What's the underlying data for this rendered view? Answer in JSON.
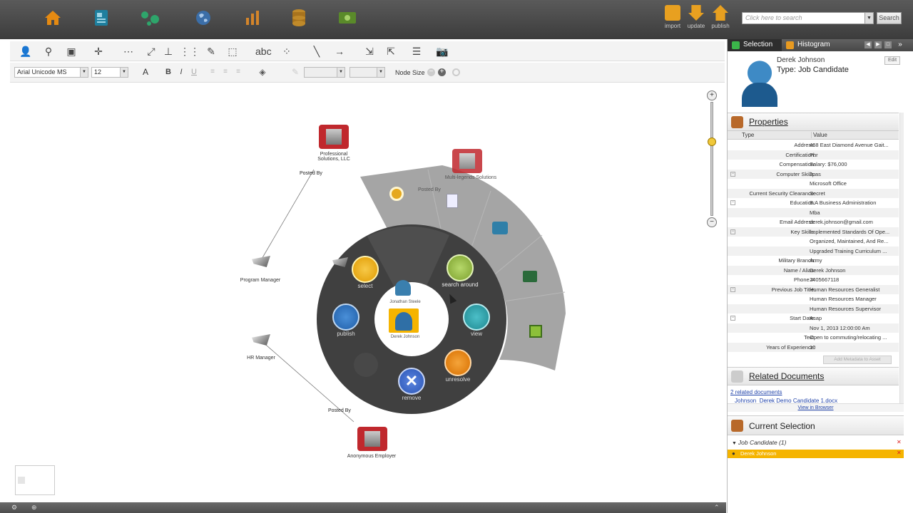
{
  "toolbar": {
    "font": "Arial Unicode MS",
    "font_size": "12",
    "node_size_label": "Node Size"
  },
  "actions": {
    "import": "import",
    "update": "update",
    "publish": "publish",
    "search_placeholder": "Click here to search",
    "search_button": "Search"
  },
  "graph": {
    "nodes": {
      "professional_solutions": "Professional Solutions, LLC",
      "multi_legends": "Multi-legends Solutions",
      "program_manager": "Program Manager",
      "hr_manager": "HR Manager",
      "anonymous_employer": "Anonymous Employer",
      "jonathan": "Jonathan Steele",
      "derek_center": "Derek Johnson"
    },
    "edges": {
      "posted_by_1": "Posted By",
      "posted_by_2": "Posted By",
      "posted_by_3": "Posted By"
    },
    "radial_menu": {
      "select": "select",
      "search_around": "search around",
      "view": "view",
      "unresolve": "unresolve",
      "remove": "remove",
      "publish": "publish"
    }
  },
  "panel": {
    "tabs": {
      "selection": "Selection",
      "histogram": "Histogram"
    },
    "edit": "Edit",
    "entity": {
      "name": "Derek Johnson",
      "type_line": "Type: Job Candidate"
    },
    "properties_title": "Properties",
    "columns": {
      "type": "Type",
      "value": "Value"
    },
    "properties": [
      {
        "k": "Address:",
        "v": "468 East Diamond Avenue Gait..."
      },
      {
        "k": "Certification:",
        "v": "Phr"
      },
      {
        "k": "Compensation:",
        "v": "Salary: $76,000"
      },
      {
        "k": "Computer Skills:",
        "v": "Jpas",
        "tog": "−"
      },
      {
        "k": "",
        "v": "Microsoft Office"
      },
      {
        "k": "Current Security Clearance:",
        "v": "Secret"
      },
      {
        "k": "Education:",
        "v": "B.A Business Administration",
        "tog": "−"
      },
      {
        "k": "",
        "v": "Mba"
      },
      {
        "k": "Email Address:",
        "v": "derek.johnson@gmail.com"
      },
      {
        "k": "Key Skills:",
        "v": "Implemented Standards Of Ope...",
        "tog": "−"
      },
      {
        "k": "",
        "v": "Organized, Maintained, And Re..."
      },
      {
        "k": "",
        "v": "Upgraded Training Curriculum ..."
      },
      {
        "k": "Military Branch:",
        "v": "Army"
      },
      {
        "k": "Name / Alias:",
        "v": "Derek Johnson"
      },
      {
        "k": "Phone #:",
        "v": "2405667118"
      },
      {
        "k": "Previous Job Title:",
        "v": "Human Resources Generalist",
        "tog": "−"
      },
      {
        "k": "",
        "v": "Human Resources Manager"
      },
      {
        "k": "",
        "v": "Human Resources Supervisor"
      },
      {
        "k": "Start Date:",
        "v": "Asap",
        "tog": "−"
      },
      {
        "k": "",
        "v": "Nov 1, 2013 12:00:00 Am"
      },
      {
        "k": "Text:",
        "v": "Open to commuting/relocating ..."
      },
      {
        "k": "Years of Experience:",
        "v": "10"
      }
    ],
    "add_btn": "Add Metadata to Asset",
    "related_title": "Related Documents",
    "related_link": "2 related documents",
    "related_doc": "Johnson_Derek Demo Candidate 1.docx",
    "view_in_browser": "View in Browser",
    "current_selection_title": "Current Selection",
    "group": "Job Candidate (1)",
    "selected_item": "Derek Johnson"
  },
  "colors": {
    "accent_orange": "#f5b400",
    "dark_wheel": "#3e3e3e",
    "building_red": "#c0282d"
  }
}
